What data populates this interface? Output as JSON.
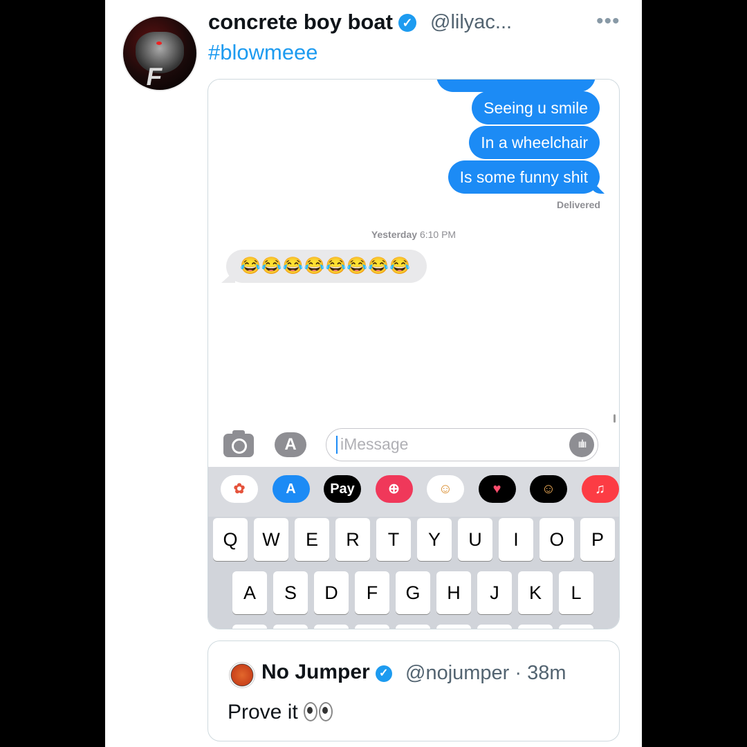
{
  "tweet": {
    "display_name": "concrete boy boat",
    "verified_glyph": "✓",
    "handle": "@lilyac...",
    "more_glyph": "•••",
    "text": "#blowmeee"
  },
  "imessage": {
    "sent": [
      "Seeing u smile",
      "In a wheelchair",
      "Is some funny shit"
    ],
    "delivered": "Delivered",
    "timestamp_day": "Yesterday",
    "timestamp_time": "6:10 PM",
    "received": "😂😂😂😂😂😂😂😂",
    "placeholder": "iMessage",
    "app_tray": [
      {
        "name": "photos-app-icon",
        "glyph": "✿",
        "bg": "#ffffff",
        "color": "#e5533c"
      },
      {
        "name": "app-store-icon",
        "glyph": "A",
        "bg": "#1c8bf5",
        "color": "#ffffff"
      },
      {
        "name": "apple-pay-icon",
        "glyph": "Pay",
        "bg": "#000000",
        "color": "#ffffff"
      },
      {
        "name": "images-search-icon",
        "glyph": "⊕",
        "bg": "#f0385a",
        "color": "#ffffff"
      },
      {
        "name": "memoji-stickers-icon",
        "glyph": "☺",
        "bg": "#ffffff",
        "color": "#d98b2b"
      },
      {
        "name": "digital-touch-icon",
        "glyph": "♥",
        "bg": "#000000",
        "color": "#ff4d6d"
      },
      {
        "name": "animoji-icon",
        "glyph": "☺",
        "bg": "#000000",
        "color": "#f5b15a"
      },
      {
        "name": "music-app-icon",
        "glyph": "♫",
        "bg": "#fc3c44",
        "color": "#ffffff"
      }
    ],
    "keyboard_row1": [
      "Q",
      "W",
      "E",
      "R",
      "T",
      "Y",
      "U",
      "I",
      "O",
      "P"
    ],
    "keyboard_row2": [
      "A",
      "S",
      "D",
      "F",
      "G",
      "H",
      "J",
      "K",
      "L"
    ]
  },
  "quote": {
    "display_name": "No Jumper",
    "verified_glyph": "✓",
    "handle_time": "@nojumper · 38m",
    "text": "Prove it"
  }
}
